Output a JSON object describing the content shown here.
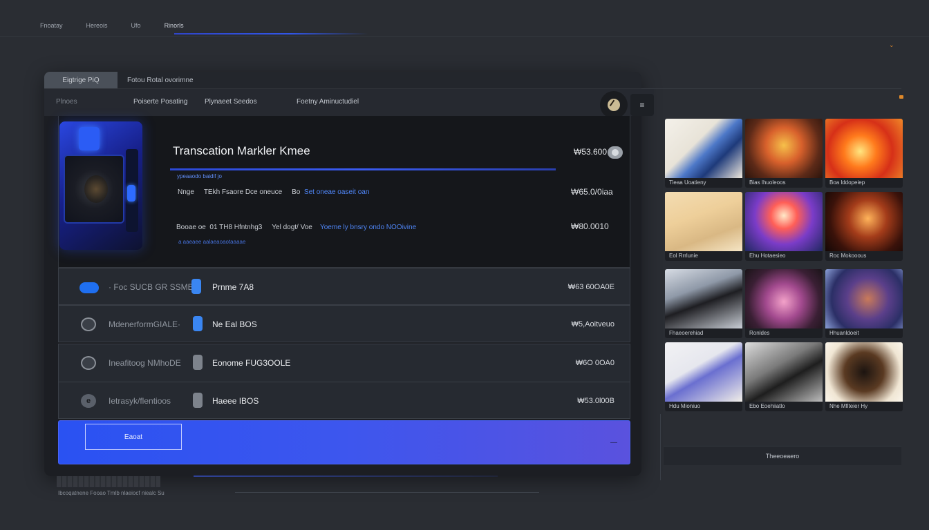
{
  "topnav": {
    "items": [
      "Fnoatay",
      "Hereois",
      "Ufo",
      "Rinorls"
    ]
  },
  "corner_mark": "⌄",
  "tabs": {
    "active": "Eigtrige PiQ",
    "inactive": "Fotou Rotal ovorimne"
  },
  "subnav": {
    "items": [
      "Plnoes",
      "Poiserte Posating",
      "Plynaeet Seedos",
      "Foetny Aminuctudiel"
    ]
  },
  "menu_glyph": "≡",
  "hero": {
    "title": "Transcation Markler Kmee",
    "price": "₩53.600",
    "subtitle": "ypeaaodo baidif jo",
    "line1": {
      "a": "Nnge",
      "b": "TEkh Fsaore Dce oneuce",
      "c": "Bo",
      "d": "Set oneae oaseit oan",
      "value": "₩65.0/0iaa"
    },
    "line2": {
      "a": "Booae oe",
      "b": "01 TH8 Hfntnhg3",
      "c": "Yel dogt/ Voe",
      "d": "Yoeme ly bnsry ondo NOOivine",
      "value": "₩80.0010"
    },
    "footer": "a aaeaee aalaeaoaotaaaae"
  },
  "rows": [
    {
      "name": "· Foc SUCB GR SSMB",
      "sub": "Prnme 7A8",
      "amount": "₩63 60OA0E",
      "icon": "toggle-icon",
      "icon_color": "#1f6ff0",
      "tag_color": "#3a86f2"
    },
    {
      "name": "MdenerformGIALE·",
      "sub": "Ne Eal BOS",
      "amount": "₩5,Aoitveuo",
      "icon": "avatar-icon",
      "icon_color": "#8a8f97",
      "tag_color": "#3a86f2"
    },
    {
      "name": "Ineafitoog NMhoDE",
      "sub": "Eonome FUG3OOLE",
      "amount": "₩6O 0OA0",
      "icon": "avatar-icon",
      "icon_color": "#8a8f97",
      "tag_color": "#7d838c"
    },
    {
      "name": "Ietrasyk/flentioos",
      "sub": "Haeee IBOS",
      "amount": "₩53.0l00B",
      "icon": "e-icon",
      "icon_color": "#8a8f97",
      "tag_color": "#7d838c"
    }
  ],
  "cta": {
    "button_label": "Eaoat",
    "dash": "—"
  },
  "footer": {
    "text": "Ibcoqatnene Fooao Tmlb nlaeiocf niealc Su"
  },
  "gallery": {
    "thumbs": [
      {
        "caption": "Tieaa   Uoatieny",
        "art": "linear-gradient(135deg,#f4f1ea 0%,#e8e3d8 40%,#4d78c8 55%,#1e3a7a 70%,#f0e9de 100%)"
      },
      {
        "caption": "Bias   Ihuoleoos",
        "art": "radial-gradient(circle at 50% 45%,#f6c04a 0%,#d8612c 35%,#5d2a18 70%,#2a140c 100%)"
      },
      {
        "caption": "Boa   lddopeiep",
        "art": "radial-gradient(circle at 45% 55%,#ffe680 0%,#ff7a1c 30%,#d63018 60%,#f08828 100%)"
      },
      {
        "caption": "Eol   Rrrlunie",
        "art": "linear-gradient(160deg,#f3dcb2 0%,#eecf9a 40%,#d9b884 70%,#f5e5c5 100%)"
      },
      {
        "caption": "Ehu   Hotaesieo",
        "art": "radial-gradient(circle at 50% 40%,#ffe9c8 0%,#ff5f57 25%,#7b3cc8 55%,#1f2860 100%)"
      },
      {
        "caption": "Roc   Mokooous",
        "art": "radial-gradient(circle at 55% 45%,#ffb35a 0%,#a43c1a 35%,#3a120a 70%,#130806 100%)"
      },
      {
        "caption": "Fhaeoerehiad",
        "art": "linear-gradient(160deg,#d7dce4 0%,#8f99a8 35%,#1e1e22 55%,#c9ced6 100%)"
      },
      {
        "caption": "Ronldes",
        "art": "radial-gradient(circle at 50% 55%,#f3a2c9 0%,#a34a8f 35%,#3a1f34 70%,#1a1418 100%)"
      },
      {
        "caption": "Hhuanldoeit",
        "art": "radial-gradient(circle at 55% 50%,#c97a5a 0%,#5b3f8a 40%,#2b2f66 70%,#8ba0d8 100%)"
      },
      {
        "caption": "Hdu   Mioniuo",
        "art": "linear-gradient(150deg,#f2f2f4 0%,#e6e7ee 40%,#6a6fd0 55%,#f1eee8 100%)"
      },
      {
        "caption": "Ebo   Eoehiiatlo",
        "art": "linear-gradient(150deg,#dcdcdc 0%,#7a7a7a 40%,#1e1e1e 60%,#bdbdbd 100%)"
      },
      {
        "caption": "Nhe   Mfiteier Hy",
        "art": "radial-gradient(circle at 50% 50%,#1c1410 0%,#5a3a22 40%,#f0e6d4 75%,#fbf6ec 100%)"
      }
    ]
  },
  "gallery_bar": {
    "label": "Theeoeaero"
  },
  "colors": {
    "background": "#2a2d33",
    "panel": "#1c1e23",
    "accent": "#2a52f2",
    "warning": "#e0892a"
  }
}
